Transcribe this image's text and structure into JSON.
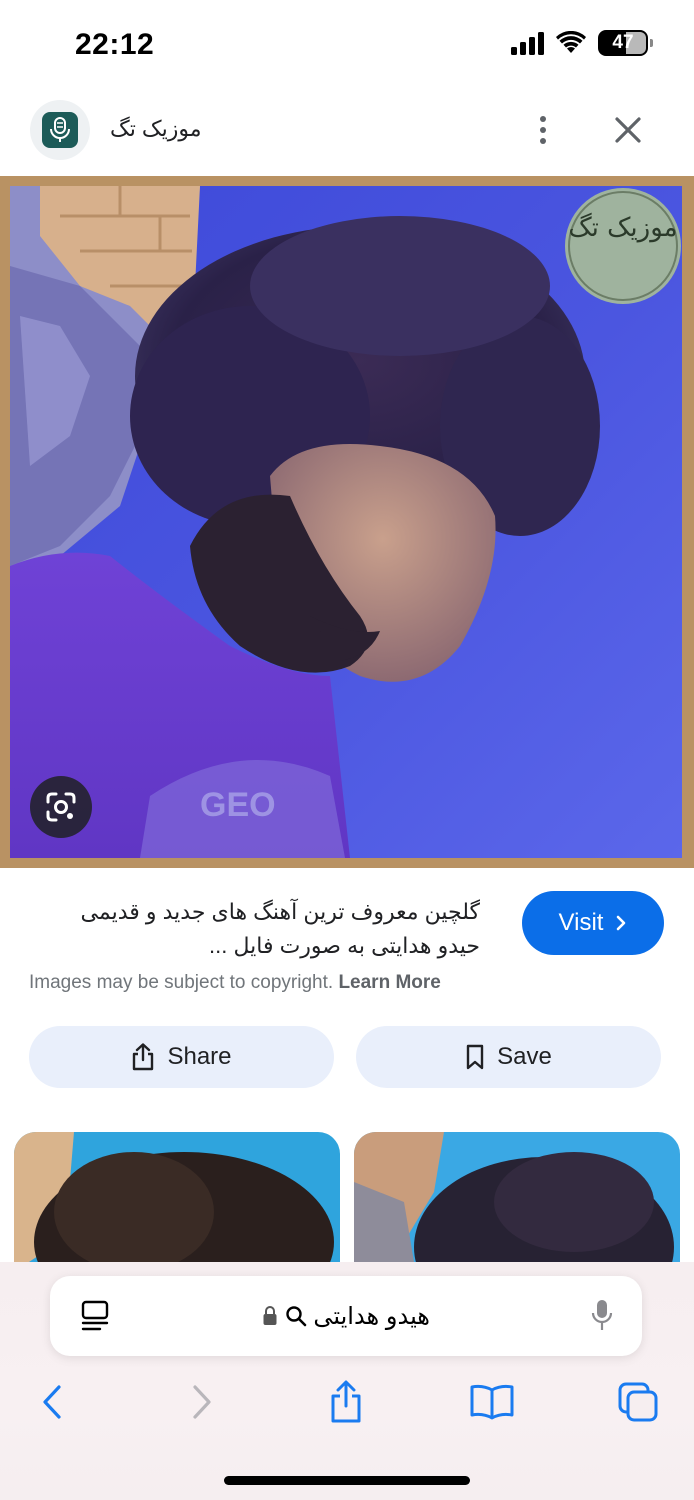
{
  "status_bar": {
    "time": "22:12",
    "battery": "47"
  },
  "header": {
    "site_name": "موزیک تگ",
    "logo_icon": "microphone-icon"
  },
  "image": {
    "watermark_text": "موزیک تگ"
  },
  "result": {
    "caption_line1": "گلچین معروف ترین آهنگ های جدید و قدیمی",
    "caption_line2": "حیدو هدایتی به صورت فایل ...",
    "visit_label": "Visit",
    "copyright_text": "Images may be subject to copyright.",
    "learn_more": "Learn More"
  },
  "actions": {
    "share_label": "Share",
    "save_label": "Save"
  },
  "browser": {
    "search_query": "هیدو هدایتی"
  },
  "colors": {
    "accent": "#0b6ee8",
    "action_bg": "#e9effb",
    "logo_bg": "#1c5b58"
  }
}
